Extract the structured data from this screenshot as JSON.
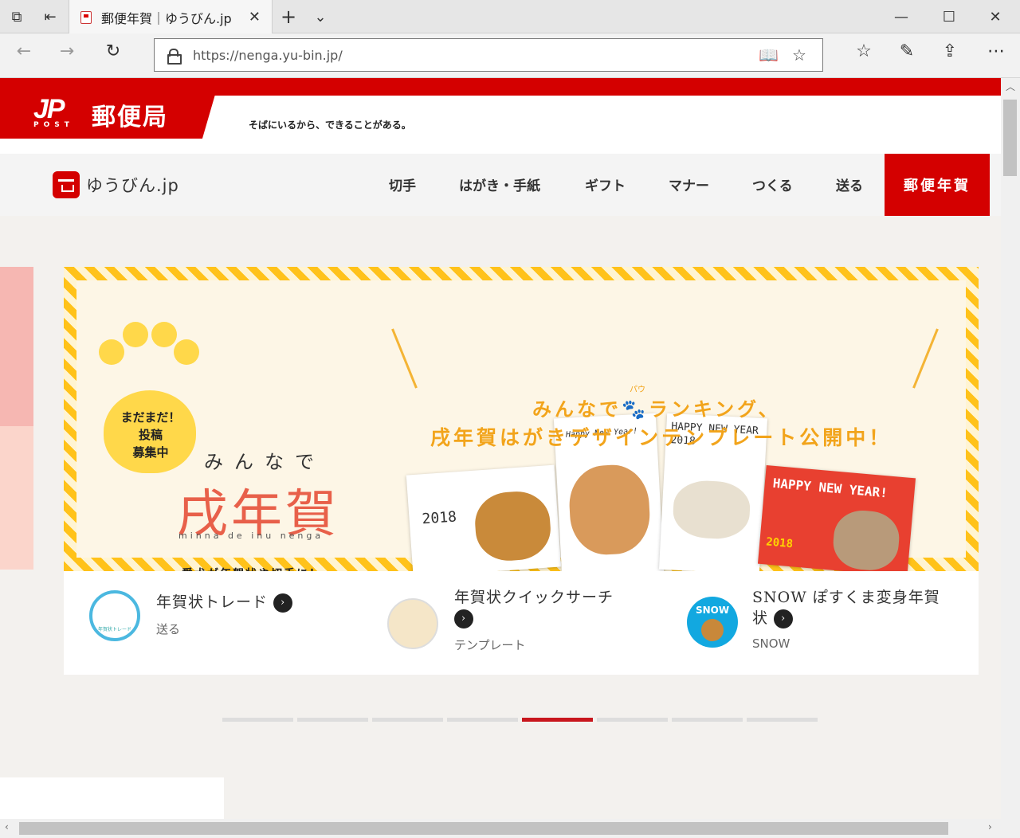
{
  "browser": {
    "tab_title": "郵便年賀｜ゆうびん.jp",
    "url": "https://nenga.yu-bin.jp/",
    "icons": {
      "tab_actions": "tabs-icon",
      "back": "arrow-left-icon",
      "forward": "arrow-right-icon",
      "refresh": "refresh-icon",
      "reading_view": "book-icon",
      "favorite": "star-icon",
      "favorites_hub": "favorites-list-icon",
      "notes": "pen-icon",
      "share": "share-icon",
      "more": "more-icon"
    },
    "window": {
      "minimize": "—",
      "maximize": "☐",
      "close": "✕"
    },
    "new_tab": "+",
    "tab_menu": "⌄"
  },
  "header": {
    "logo_mark": "JP",
    "logo_post": "POST",
    "logo_name": "郵便局",
    "tagline": "そばにいるから、できることがある。"
  },
  "nav": {
    "site_name": "ゆうびん.jp",
    "items": [
      "切手",
      "はがき・手紙",
      "ギフト",
      "マナー",
      "つくる",
      "送る"
    ],
    "active": "郵便年賀"
  },
  "banner": {
    "paw_text": [
      "まだまだ！",
      "投稿",
      "募集中"
    ],
    "minnade": "みんなで",
    "main_title": "戌年賀",
    "romaji": "minna de inu nenga",
    "subcopy": "愛犬が年賀状や切手に！",
    "ranking_line1": "みんなで🐾ランキング、",
    "ranking_line2": "戌年賀はがきデザインテンプレート公開中！",
    "ruby": "パウ",
    "cards": [
      "2018",
      "Happy New Year!",
      "HAPPY NEW YEAR 2018",
      "HAPPY NEW YEAR!",
      "2018"
    ]
  },
  "links": [
    {
      "title": "年賀状トレード",
      "sub": "送る",
      "icon": "trade-icon",
      "icon_label": "年賀状トレード"
    },
    {
      "title": "年賀状クイックサーチ",
      "sub": "テンプレート",
      "icon": "shiba-dog-icon"
    },
    {
      "title": "SNOW ぽすくま変身年賀状",
      "sub": "SNOW",
      "icon": "snow-bear-icon",
      "icon_label": "SNOW"
    }
  ],
  "carousel": {
    "count": 8,
    "active_index": 4
  },
  "colors": {
    "brand_red": "#d40000",
    "banner_yellow": "#ffc21a",
    "accent_orange": "#f2a41b",
    "title_coral": "#e8604a"
  }
}
